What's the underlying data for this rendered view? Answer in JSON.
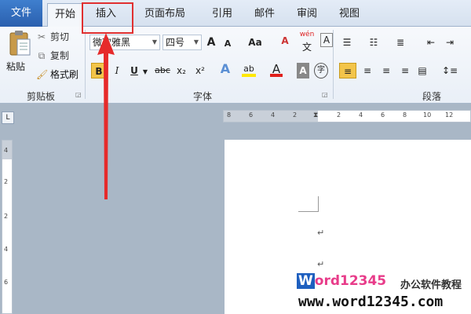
{
  "tabs": {
    "file": "文件",
    "home": "开始",
    "insert": "插入",
    "layout": "页面布局",
    "references": "引用",
    "mailings": "邮件",
    "review": "审阅",
    "view": "视图"
  },
  "clipboard": {
    "paste": "粘贴",
    "cut": "剪切",
    "copy": "复制",
    "format_painter": "格式刷",
    "group_label": "剪贴板"
  },
  "font": {
    "name": "微软雅黑",
    "size": "四号",
    "grow": "A",
    "shrink": "A",
    "change_case": "Aa",
    "clear_format": "A",
    "phonetic": "wén",
    "phonetic_char": "文",
    "bold": "B",
    "italic": "I",
    "underline": "U",
    "strikethrough": "abc",
    "subscript": "x₂",
    "superscript": "x²",
    "highlight_text": "ab",
    "font_color": "A",
    "char_shade": "A",
    "enclose": "字",
    "group_label": "字体"
  },
  "paragraph": {
    "group_label": "段落"
  },
  "ruler": {
    "top": [
      "8",
      "6",
      "4",
      "2",
      "2",
      "4",
      "6",
      "8",
      "10",
      "12"
    ],
    "left": [
      "4",
      "2",
      "2",
      "4",
      "6"
    ],
    "corner": "L"
  },
  "document": {
    "mark1": "↵",
    "mark2": "↵"
  },
  "watermark": {
    "brand_w": "W",
    "brand_rest": "ord12345",
    "subtitle": "办公软件教程",
    "url": "www.word12345.com"
  },
  "colors": {
    "accent": "#2a5fae",
    "highlight": "#e03030",
    "bold_active": "#f3c54a"
  }
}
